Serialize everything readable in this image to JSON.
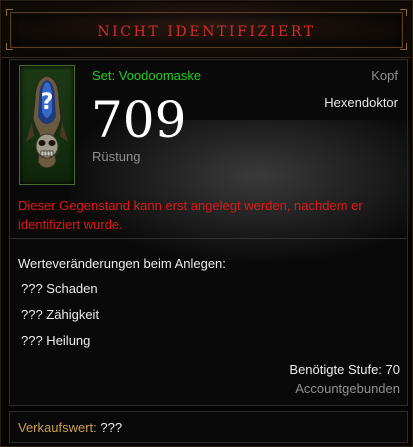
{
  "header": {
    "title": "NICHT IDENTIFIZIERT"
  },
  "item": {
    "set_name": "Set: Voodoomaske",
    "slot": "Kopf",
    "class": "Hexendoktor",
    "armor_value": "709",
    "armor_label": "Rüstung",
    "icon": "voodoo-mask-unidentified-icon",
    "unidentified_mark": "?"
  },
  "warning": "Dieser Gegenstand kann erst angelegt werden, nachdem er identifiziert wurde.",
  "changes": {
    "heading": "Werteveränderungen beim Anlegen:",
    "stats": [
      "??? Schaden",
      "??? Zähigkeit",
      "??? Heilung"
    ]
  },
  "requirements": {
    "level": "Benötigte Stufe: 70",
    "binding": "Accountgebunden"
  },
  "footer": {
    "sell_label": "Verkaufswert:",
    "sell_value": "???"
  },
  "colors": {
    "title": "#d42a2a",
    "set_name": "#1fd01f",
    "warning": "#e01818",
    "muted": "#8f8f8f",
    "sell_label": "#c8a050"
  }
}
